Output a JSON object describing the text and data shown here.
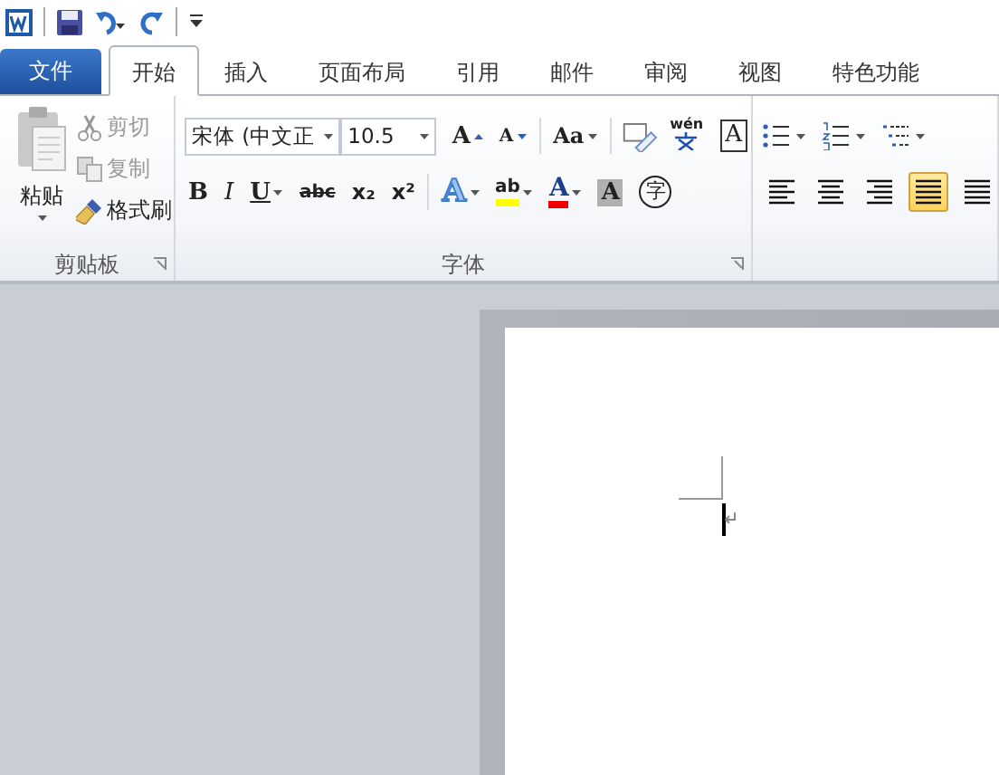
{
  "quick_access": {
    "items": [
      {
        "kind": "app"
      },
      {
        "kind": "save"
      },
      {
        "kind": "undo"
      },
      {
        "kind": "redo"
      },
      {
        "kind": "customize"
      }
    ]
  },
  "tabs": [
    {
      "label": "文件",
      "kind": "file",
      "selected": false
    },
    {
      "label": "开始",
      "kind": "tab",
      "selected": true
    },
    {
      "label": "插入",
      "kind": "tab",
      "selected": false
    },
    {
      "label": "页面布局",
      "kind": "tab",
      "selected": false
    },
    {
      "label": "引用",
      "kind": "tab",
      "selected": false
    },
    {
      "label": "邮件",
      "kind": "tab",
      "selected": false
    },
    {
      "label": "审阅",
      "kind": "tab",
      "selected": false
    },
    {
      "label": "视图",
      "kind": "tab",
      "selected": false
    },
    {
      "label": "特色功能",
      "kind": "tab",
      "selected": false
    }
  ],
  "clipboard": {
    "label": "剪贴板",
    "paste": "粘贴",
    "items": [
      {
        "label": "剪切",
        "kind": "cut",
        "disabled": true
      },
      {
        "label": "复制",
        "kind": "copy",
        "disabled": true
      },
      {
        "label": "格式刷",
        "kind": "brush",
        "disabled": false
      }
    ]
  },
  "font": {
    "label": "字体",
    "font_name": "宋体 (中文正",
    "font_size": "10.5",
    "row1": [
      {
        "label": "A",
        "kind": "grow"
      },
      {
        "label": "A",
        "kind": "shrink"
      },
      {
        "label": "Aa",
        "kind": "case"
      },
      {
        "kind": "clear"
      },
      {
        "label": "wén",
        "kind": "pinyin"
      },
      {
        "label": "A",
        "kind": "border"
      }
    ],
    "row2": [
      {
        "label": "B",
        "kind": "bold"
      },
      {
        "label": "I",
        "kind": "italic"
      },
      {
        "label": "U",
        "kind": "underline"
      },
      {
        "label": "abc",
        "kind": "strike"
      },
      {
        "label": "x₂",
        "kind": "sub"
      },
      {
        "label": "x²",
        "kind": "sup"
      },
      {
        "label": "A",
        "kind": "effects"
      },
      {
        "label": "ab",
        "kind": "highlight"
      },
      {
        "label": "A",
        "kind": "color"
      },
      {
        "label": "A",
        "kind": "shade"
      },
      {
        "label": "字",
        "kind": "enclose"
      }
    ]
  },
  "paragraph": {
    "lists": [
      {
        "kind": "bullets"
      },
      {
        "kind": "numbering"
      },
      {
        "kind": "multilevel"
      }
    ],
    "align": [
      {
        "kind": "left",
        "selected": false
      },
      {
        "kind": "center",
        "selected": false
      },
      {
        "kind": "right",
        "selected": false
      },
      {
        "kind": "justify",
        "selected": true
      },
      {
        "kind": "distributed",
        "selected": false
      }
    ]
  }
}
